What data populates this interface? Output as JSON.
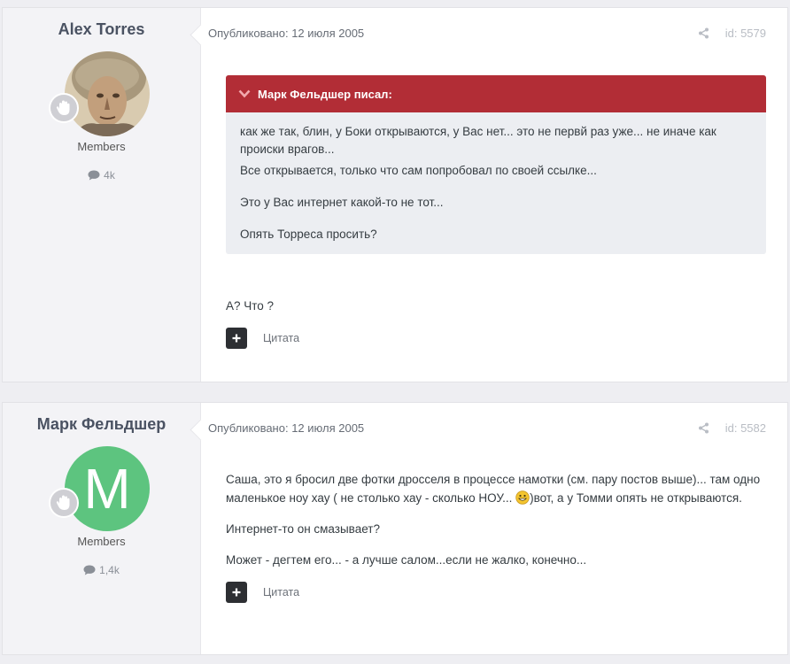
{
  "posts": [
    {
      "author": {
        "name": "Alex Torres",
        "group": "Members",
        "post_count": "4k",
        "avatar": "portrait-photo"
      },
      "date_label": "Опубликовано: 12 июля 2005",
      "post_id": "id: 5579",
      "quote": {
        "header": "Марк Фельдшер писал:",
        "lines": [
          "как же так, блин, у Боки открываются, у Вас нет... это не первй раз уже... не иначе как происки врагов...",
          "Все открывается, только что сам попробовал по своей ссылке...",
          "Это у Вас интернет какой-то не тот...",
          "Опять Торреса просить?"
        ]
      },
      "body": [
        "А? Что ?"
      ],
      "quote_label": "Цитата"
    },
    {
      "author": {
        "name": "Марк Фельдшер",
        "group": "Members",
        "post_count": "1,4k",
        "avatar_letter": "M",
        "avatar_color": "#5dc47f"
      },
      "date_label": "Опубликовано: 12 июля 2005",
      "post_id": "id: 5582",
      "body_1_before": "Саша, это я бросил две фотки дросселя в процессе намотки (см. пару постов выше)... там одно маленькое ноу хау ( не столько хау - сколько НОУ...",
      "body_1_after": ")вот, а у Томми опять не открываются.",
      "body": [
        "Интернет-то он смазывает?",
        "Может - дегтем его... - а лучше салом...если не жалко, конечно..."
      ],
      "quote_label": "Цитата"
    }
  ],
  "colors": {
    "quote_header": "#b22d36",
    "page_bg": "#eeeef2",
    "avatar_m": "#5dc47f"
  }
}
